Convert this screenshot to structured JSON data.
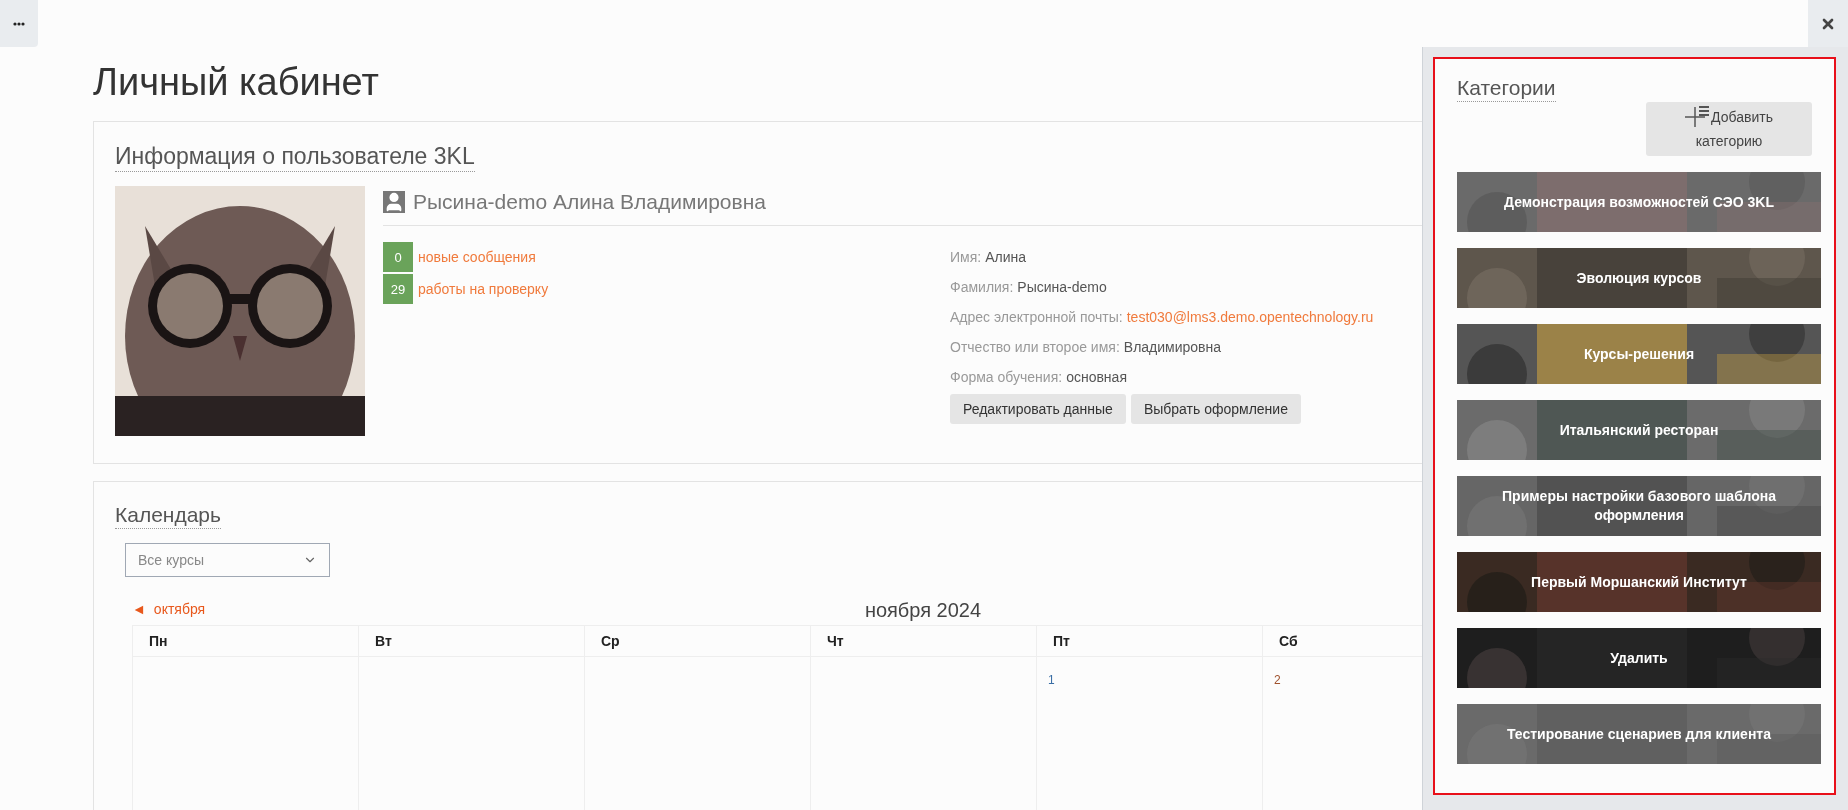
{
  "page_title": "Личный кабинет",
  "user_card": {
    "heading": "Информация о пользователе 3KL",
    "full_name": "Рысина-demo Алина Владимировна",
    "counters": [
      {
        "count": "0",
        "label": "новые сообщения"
      },
      {
        "count": "29",
        "label": "работы на проверку"
      }
    ],
    "fields": [
      {
        "label": "Имя:",
        "value": "Алина",
        "kind": "text"
      },
      {
        "label": "Фамилия:",
        "value": "Рысина-demo",
        "kind": "text"
      },
      {
        "label": "Адрес электронной почты:",
        "value": "test030@lms3.demo.opentechnology.ru",
        "kind": "link"
      },
      {
        "label": "Отчество или второе имя:",
        "value": "Владимировна",
        "kind": "text"
      },
      {
        "label": "Форма обучения:",
        "value": "основная",
        "kind": "text"
      }
    ],
    "buttons": [
      "Редактировать данные",
      "Выбрать оформление"
    ]
  },
  "calendar": {
    "heading": "Календарь",
    "course_select": {
      "value": "Все курсы"
    },
    "prev_month": {
      "arrow": "◄",
      "label": "октября"
    },
    "month_title": "ноября 2024",
    "weekdays": [
      "Пн",
      "Вт",
      "Ср",
      "Чт",
      "Пт",
      "Сб"
    ],
    "week": [
      {
        "kind": "blank"
      },
      {
        "kind": "blank"
      },
      {
        "kind": "blank"
      },
      {
        "kind": "blank"
      },
      {
        "kind": "day",
        "day": "1",
        "weekend": false
      },
      {
        "kind": "day",
        "day": "2",
        "weekend": true
      }
    ]
  },
  "categories_panel": {
    "heading": "Категории",
    "add_button": "Добавить категорию",
    "categories": [
      {
        "title": "Демонстрация возможностей СЭО 3KL",
        "kind": "picture"
      },
      {
        "title": "Эволюция курсов",
        "kind": "picture"
      },
      {
        "title": "Курсы-решения",
        "kind": "picture"
      },
      {
        "title": "Итальянский ресторан",
        "kind": "picture"
      },
      {
        "title": "Примеры настройки базового шаблона оформления",
        "kind": "picture"
      },
      {
        "title": "Первый Моршанский Институт",
        "kind": "picture"
      },
      {
        "title": "Удалить",
        "kind": "picture"
      },
      {
        "title": "Тестирование сценариев для клиента",
        "kind": "picture"
      }
    ]
  }
}
